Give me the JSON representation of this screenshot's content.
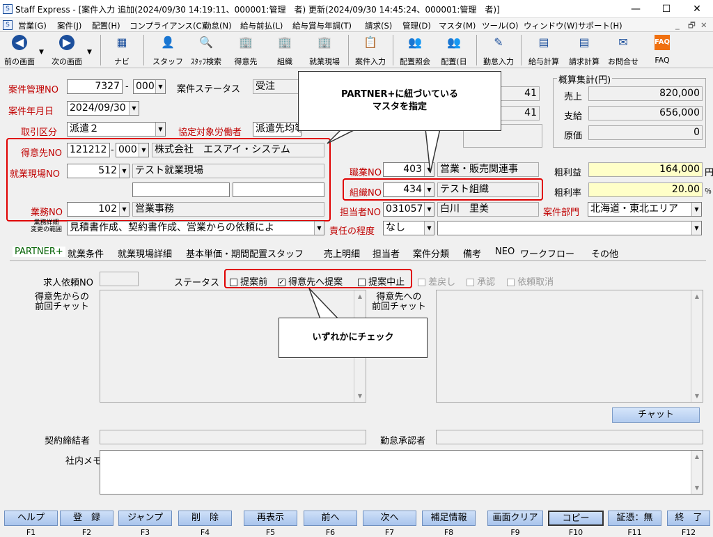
{
  "window": {
    "title": "Staff Express - [案件入力 追加(2024/09/30 14:19:11、000001:管理　者) 更新(2024/09/30 14:45:24、000001:管理　者)]",
    "minimize": "—",
    "maximize": "☐",
    "close": "✕"
  },
  "menu": [
    "営業(G)",
    "案件(J)",
    "配置(H)",
    "コンプライアンス(C)",
    "勤怠(N)",
    "給与前払(L)",
    "給与賞与年調(T)",
    "請求(S)",
    "管理(D)",
    "マスタ(M)",
    "ツール(O)",
    "ウィンドウ(W)",
    "サポート(H)"
  ],
  "menu_right": {
    "min": "_",
    "restore": "🗗",
    "close": "✕"
  },
  "toolbar": {
    "back": "前の画面",
    "next": "次の画面",
    "navi": "ナビ",
    "staff": "スタッフ",
    "staff_search": "ｽﾀｯﾌ検索",
    "client": "得意先",
    "org": "組織",
    "site": "就業現場",
    "case_input": "案件入力",
    "placement_ref": "配置照会",
    "placement_day": "配置(日",
    "attendance": "勤怠入力",
    "payroll": "給与計算",
    "billing": "請求計算",
    "contact": "お問合せ",
    "faq": "FAQ"
  },
  "form": {
    "case_no_label": "案件管理NO",
    "case_no": "7327",
    "case_no_dash": "-",
    "case_sub": "000",
    "status_label": "案件ステータス",
    "status": "受注",
    "date_label": "案件年月日",
    "date": "2024/09/30",
    "trade_label": "取引区分",
    "trade": "派遣２",
    "worker_label": "協定対象労働者",
    "worker": "派遣先均等",
    "client_label": "得意先NO",
    "client_no": "121212",
    "client_sub": "000",
    "client_name": "株式会社　エスアイ・システム",
    "site_label": "就業現場NO",
    "site_no": "512",
    "site_name": "テスト就業現場",
    "duty_label": "業務NO",
    "duty_no": "102",
    "duty_name": "営業事務",
    "job_label": "職業NO",
    "job_no": "403",
    "job_name": "営業・販売関連事",
    "org_label": "組織NO",
    "org_no": "434",
    "org_name": "テスト組織",
    "staff_label": "担当者NO",
    "staff_no": "031057",
    "staff_name": "白川　里美",
    "dept_label": "案件部門",
    "dept": "北海道・東北エリア",
    "scope_label1": "業務詳細",
    "scope_label2": "変更の範囲",
    "scope": "見積書作成、契約書作成、営業からの依頼によ",
    "resp_label": "責任の程度",
    "resp": "なし",
    "count1": "41",
    "count2": "41"
  },
  "summary": {
    "title": "概算集計(円)",
    "sales_label": "売上",
    "sales": "820,000",
    "pay_label": "支給",
    "pay": "656,000",
    "cost_label": "原価",
    "cost": "0",
    "profit_label": "粗利益",
    "profit": "164,000",
    "profit_unit": "円",
    "rate_label": "粗利率",
    "rate": "20.00",
    "rate_unit": "％"
  },
  "tabs": [
    "PARTNER+",
    "就業条件",
    "就業現場詳細",
    "基本単価・期間配置スタッフ",
    "売上明細",
    "担当者",
    "案件分類",
    "備考",
    "NEO",
    "ワークフロー",
    "その他"
  ],
  "partner": {
    "req_label": "求人依頼NO",
    "status_label": "ステータス",
    "statuses": [
      "提案前",
      "得意先へ提案",
      "提案中止",
      "差戻し",
      "承認",
      "依頼取消"
    ],
    "checked_mark": "✓",
    "chat_from_label": [
      "得意先からの",
      "前回チャット"
    ],
    "chat_to_label": [
      "得意先への",
      "前回チャット"
    ],
    "chat_button": "チャット",
    "contract_label": "契約締結者",
    "approver_label": "勤怠承認者",
    "memo_label": "社内メモ"
  },
  "callouts": {
    "master": [
      "PARTNER+に紐づいている",
      "マスタを指定"
    ],
    "check": "いずれかにチェック"
  },
  "fkeys": [
    {
      "label": "ヘルプ",
      "key": "F1"
    },
    {
      "label": "登　録",
      "key": "F2"
    },
    {
      "label": "ジャンプ",
      "key": "F3"
    },
    {
      "label": "削　除",
      "key": "F4"
    },
    {
      "label": "再表示",
      "key": "F5"
    },
    {
      "label": "前へ",
      "key": "F6"
    },
    {
      "label": "次へ",
      "key": "F7"
    },
    {
      "label": "補足情報",
      "key": "F8"
    },
    {
      "label": "画面クリア",
      "key": "F9"
    },
    {
      "label": "コピー",
      "key": "F10"
    },
    {
      "label": "証憑：無",
      "key": "F11"
    },
    {
      "label": "終　了",
      "key": "F12"
    }
  ],
  "colors": {
    "red_label": "#c00000",
    "highlight": "#e00000",
    "fkey": "#a8c4ec",
    "yellow": "#ffffc8"
  }
}
